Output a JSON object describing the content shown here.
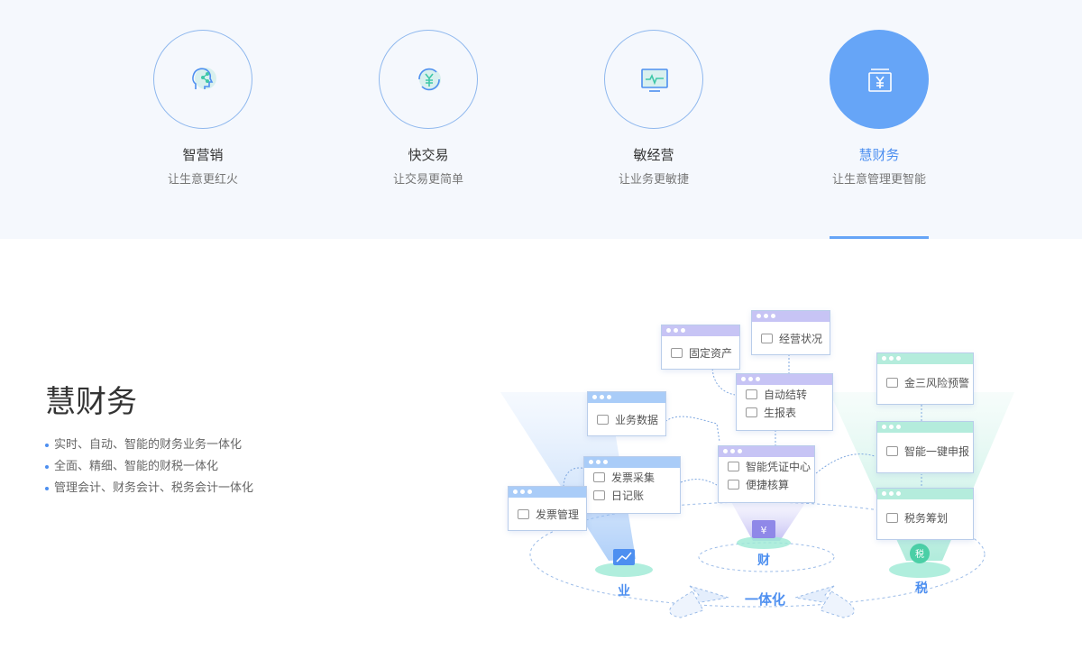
{
  "tabs": [
    {
      "title": "智营销",
      "subtitle": "让生意更红火",
      "icon": "marketing-head-icon"
    },
    {
      "title": "快交易",
      "subtitle": "让交易更简单",
      "icon": "yuan-exchange-icon"
    },
    {
      "title": "敏经营",
      "subtitle": "让业务更敏捷",
      "icon": "monitor-chart-icon"
    },
    {
      "title": "慧财务",
      "subtitle": "让生意管理更智能",
      "icon": "yuan-finance-icon"
    }
  ],
  "section": {
    "title": "慧财务",
    "bullets": [
      "实时、自动、智能的财务业务一体化",
      "全面、精细、智能的财税一体化",
      "管理会计、财务会计、税务会计一体化"
    ]
  },
  "diagram": {
    "cards": {
      "fixed_assets": "固定资产",
      "business_status": "经营状况",
      "auto_transfer": "自动结转",
      "generate_report": "生报表",
      "business_data": "业务数据",
      "invoice_collect": "发票采集",
      "journal": "日记账",
      "invoice_manage": "发票管理",
      "voucher_center": "智能凭证中心",
      "quick_check": "便捷核算",
      "risk_warning": "金三风险预警",
      "one_click_report": "智能一键申报",
      "tax_planning": "税务筹划"
    },
    "labels": {
      "business": "业",
      "finance": "财",
      "tax": "税",
      "integration": "一体化"
    }
  },
  "colors": {
    "accent": "#66a5f7",
    "accent_text": "#4d8ff0",
    "top_bg": "#f5f8fd"
  }
}
